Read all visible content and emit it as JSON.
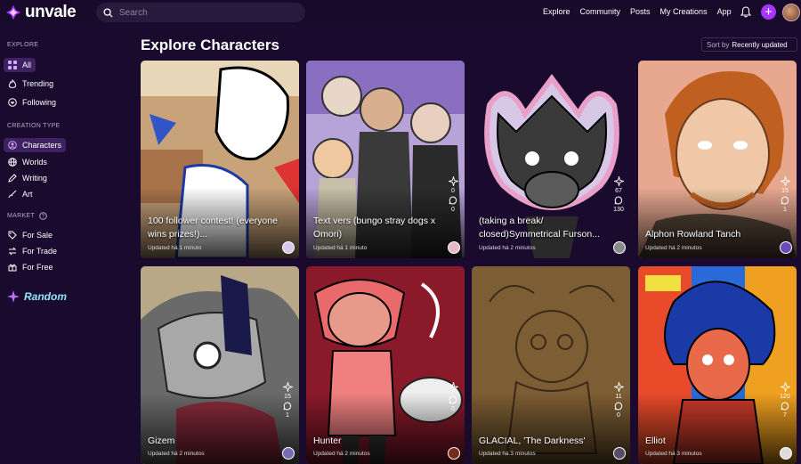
{
  "app": {
    "name": "unvale"
  },
  "search": {
    "placeholder": "Search"
  },
  "nav": {
    "items": [
      "Explore",
      "Community",
      "Posts",
      "My Creations",
      "App"
    ]
  },
  "sidebar": {
    "explore_header": "EXPLORE",
    "explore": [
      "All",
      "Trending",
      "Following"
    ],
    "creation_header": "CREATION TYPE",
    "creation": [
      "Characters",
      "Worlds",
      "Writing",
      "Art"
    ],
    "market_header": "MARKET",
    "market": [
      "For Sale",
      "For Trade",
      "For Free"
    ],
    "random": "Random"
  },
  "page": {
    "title": "Explore Characters",
    "sort_prefix": "Sort by",
    "sort_value": "Recently updated"
  },
  "cards": [
    {
      "name": "100 follower contest! (everyone wins prizes!)...",
      "updated": "Updated há 1 minuto",
      "likes": "",
      "comments": ""
    },
    {
      "name": "Text vers (bungo stray dogs x Omori)",
      "updated": "Updated há 1 minuto",
      "likes": "0",
      "comments": "0"
    },
    {
      "name": "(taking a break/ closed)Symmetrical Furson...",
      "updated": "Updated há 2 minutos",
      "likes": "67",
      "comments": "130"
    },
    {
      "name": "Alphon Rowland Tanch",
      "updated": "Updated há 2 minutos",
      "likes": "15",
      "comments": "1"
    },
    {
      "name": "Gizem",
      "updated": "Updated há 2 minutos",
      "likes": "15",
      "comments": "1"
    },
    {
      "name": "Hunter",
      "updated": "Updated há 2 minutos",
      "likes": "",
      "comments": "0"
    },
    {
      "name": "GLACIAL, 'The Darkness'",
      "updated": "Updated há 3 minutos",
      "likes": "11",
      "comments": "0"
    },
    {
      "name": "Elliot",
      "updated": "Updated há 3 minutos",
      "likes": "120",
      "comments": "7"
    }
  ],
  "colors": {
    "background": "#1a0b2e",
    "accent": "#a535ff",
    "active": "#3d2160"
  }
}
